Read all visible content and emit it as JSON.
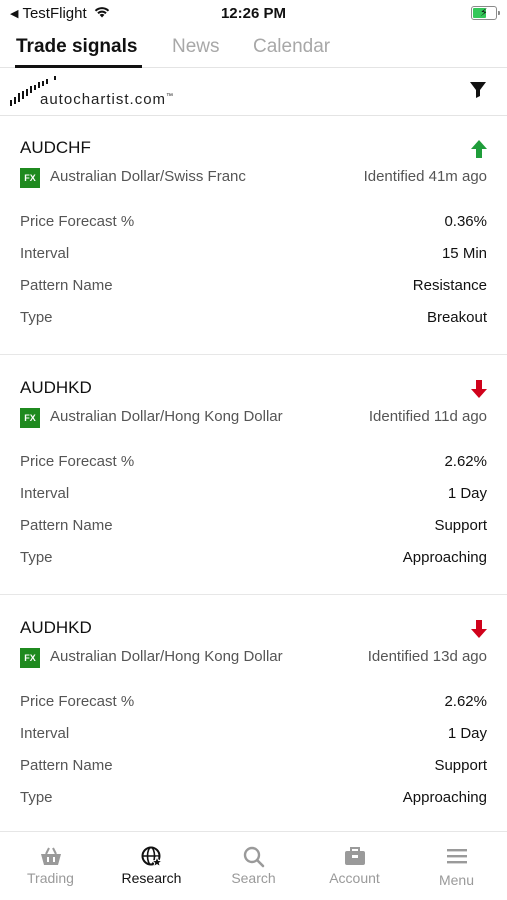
{
  "status_bar": {
    "back_app": "TestFlight",
    "time": "12:26 PM",
    "battery_level": 0.6
  },
  "tabs": [
    {
      "label": "Trade signals",
      "active": true
    },
    {
      "label": "News",
      "active": false
    },
    {
      "label": "Calendar",
      "active": false
    }
  ],
  "logo": {
    "text": "autochartist.com",
    "tm": "™"
  },
  "icons": {
    "filter": "filter-funnel-icon",
    "up_arrow": "arrow-up-icon",
    "down_arrow": "arrow-down-icon"
  },
  "colors": {
    "up": "#1f9d3a",
    "down": "#d0021b",
    "fx_badge": "#1f8a1f"
  },
  "signals": [
    {
      "symbol": "AUDCHF",
      "direction": "up",
      "badge": "FX",
      "name": "Australian Dollar/Swiss Franc",
      "identified": "Identified 41m ago",
      "rows": [
        {
          "label": "Price Forecast %",
          "value": "0.36%"
        },
        {
          "label": "Interval",
          "value": "15 Min"
        },
        {
          "label": "Pattern Name",
          "value": "Resistance"
        },
        {
          "label": "Type",
          "value": "Breakout"
        }
      ]
    },
    {
      "symbol": "AUDHKD",
      "direction": "down",
      "badge": "FX",
      "name": "Australian Dollar/Hong Kong Dollar",
      "identified": "Identified 11d ago",
      "rows": [
        {
          "label": "Price Forecast %",
          "value": "2.62%"
        },
        {
          "label": "Interval",
          "value": "1 Day"
        },
        {
          "label": "Pattern Name",
          "value": "Support"
        },
        {
          "label": "Type",
          "value": "Approaching"
        }
      ]
    },
    {
      "symbol": "AUDHKD",
      "direction": "down",
      "badge": "FX",
      "name": "Australian Dollar/Hong Kong Dollar",
      "identified": "Identified 13d ago",
      "rows": [
        {
          "label": "Price Forecast %",
          "value": "2.62%"
        },
        {
          "label": "Interval",
          "value": "1 Day"
        },
        {
          "label": "Pattern Name",
          "value": "Support"
        },
        {
          "label": "Type",
          "value": "Approaching"
        }
      ]
    }
  ],
  "bottom_nav": [
    {
      "label": "Trading",
      "icon": "basket-icon",
      "active": false
    },
    {
      "label": "Research",
      "icon": "globe-star-icon",
      "active": true
    },
    {
      "label": "Search",
      "icon": "search-icon",
      "active": false
    },
    {
      "label": "Account",
      "icon": "briefcase-icon",
      "active": false
    },
    {
      "label": "Menu",
      "icon": "hamburger-menu-icon",
      "active": false
    }
  ]
}
